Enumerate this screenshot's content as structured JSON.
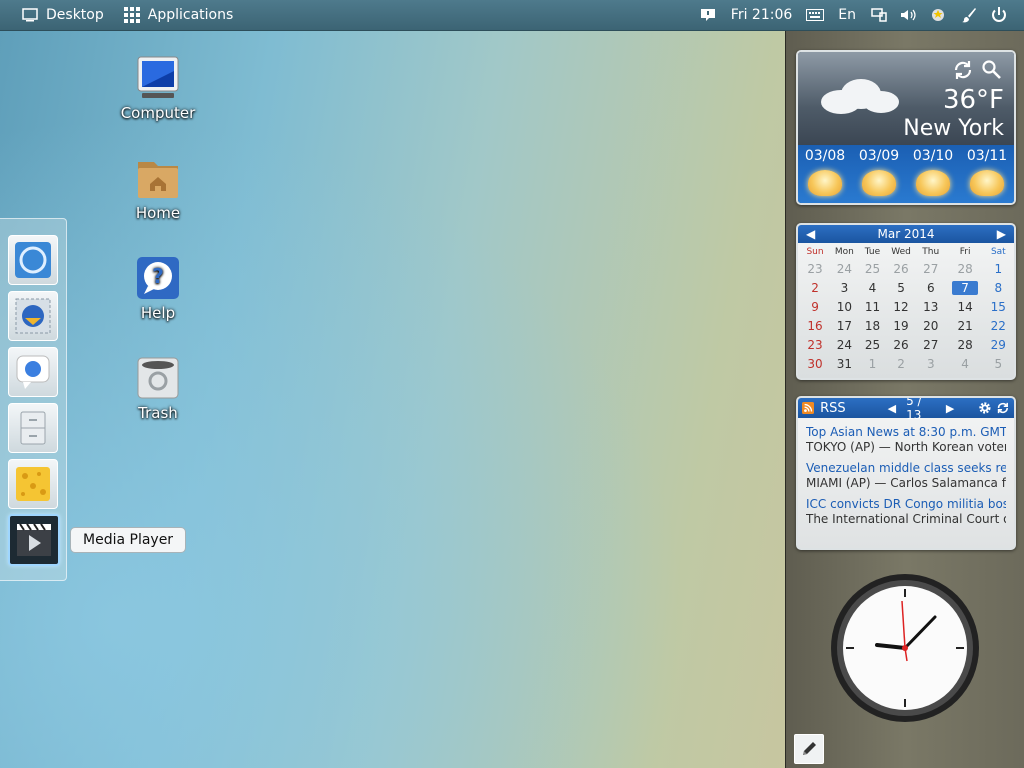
{
  "topbar": {
    "desktop_label": "Desktop",
    "applications_label": "Applications",
    "clock": "Fri 21:06",
    "language": "En"
  },
  "desktop_icons": {
    "computer": "Computer",
    "home": "Home",
    "help": "Help",
    "trash": "Trash"
  },
  "dock": {
    "items": [
      "browser-icon",
      "email-client-icon",
      "chat-icon",
      "file-manager-icon",
      "cheese-icon",
      "media-player-icon"
    ],
    "tooltip": "Media Player"
  },
  "weather": {
    "temperature": "36°F",
    "city": "New York",
    "forecast": [
      {
        "date": "03/08"
      },
      {
        "date": "03/09"
      },
      {
        "date": "03/10"
      },
      {
        "date": "03/11"
      }
    ]
  },
  "calendar": {
    "month": "Mar 2014",
    "weekdays": [
      "Sun",
      "Mon",
      "Tue",
      "Wed",
      "Thu",
      "Fri",
      "Sat"
    ],
    "weeks": [
      [
        "23",
        "24",
        "25",
        "26",
        "27",
        "28",
        "1"
      ],
      [
        "2",
        "3",
        "4",
        "5",
        "6",
        "7",
        "8"
      ],
      [
        "9",
        "10",
        "11",
        "12",
        "13",
        "14",
        "15"
      ],
      [
        "16",
        "17",
        "18",
        "19",
        "20",
        "21",
        "22"
      ],
      [
        "23",
        "24",
        "25",
        "26",
        "27",
        "28",
        "29"
      ],
      [
        "30",
        "31",
        "1",
        "2",
        "3",
        "4",
        "5"
      ]
    ],
    "today": "7"
  },
  "rss": {
    "label": "RSS",
    "page": "5 / 13",
    "items": [
      {
        "title": "Top Asian News at 8:30 p.m. GMT",
        "desc": "TOKYO (AP) — North Korean voter…"
      },
      {
        "title": "Venezuelan middle class seeks refu…",
        "desc": "MIAMI (AP) — Carlos Salamanca fl…"
      },
      {
        "title": "ICC convicts DR Congo militia boss…",
        "desc": "The International Criminal Court o…"
      }
    ]
  },
  "colors": {
    "accent": "#1b5db5",
    "sunday": "#c0312b",
    "saturday": "#2a6fc8"
  }
}
